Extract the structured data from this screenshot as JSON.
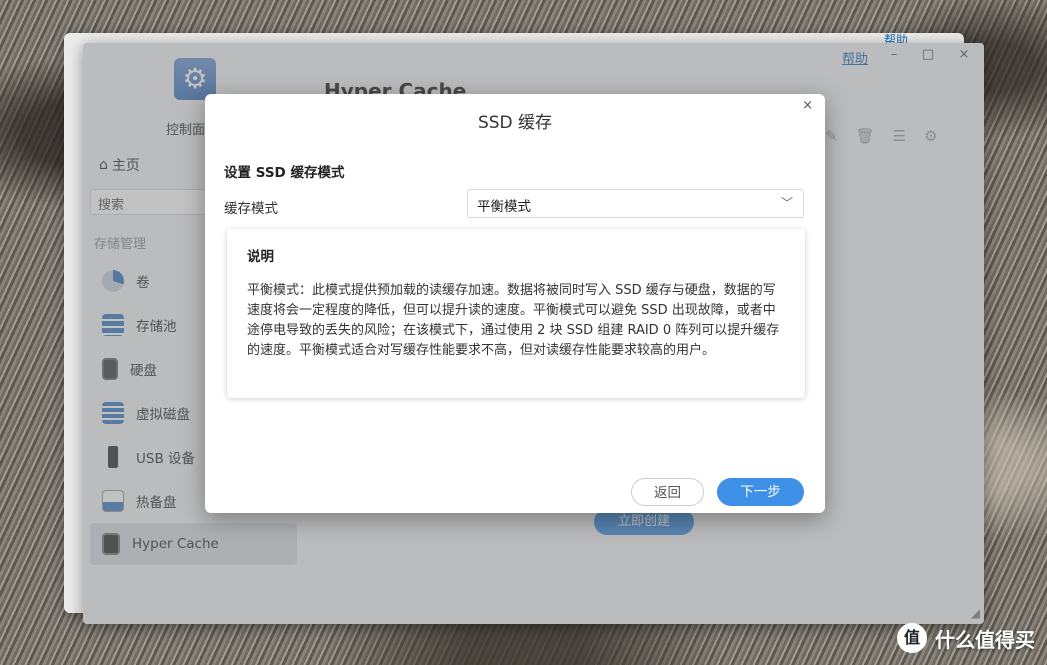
{
  "back_window": {
    "help": "帮助"
  },
  "window": {
    "help": "帮助",
    "minimize": "–",
    "maximize": "□",
    "close": "×",
    "app_name": "控制面",
    "content_title": "Hyper Cache",
    "create_button": "立即创建"
  },
  "sidebar": {
    "home": "主页",
    "search_placeholder": "搜索",
    "section": "存储管理",
    "items": [
      {
        "label": "卷",
        "icon": "volume-pie-icon"
      },
      {
        "label": "存储池",
        "icon": "storage-pool-icon"
      },
      {
        "label": "硬盘",
        "icon": "hard-disk-icon"
      },
      {
        "label": "虚拟磁盘",
        "icon": "virtual-disk-icon"
      },
      {
        "label": "USB 设备",
        "icon": "usb-device-icon"
      },
      {
        "label": "热备盘",
        "icon": "hot-spare-icon"
      },
      {
        "label": "Hyper Cache",
        "icon": "hyper-cache-icon"
      }
    ]
  },
  "modal": {
    "title": "SSD 缓存",
    "close": "×",
    "section_title": "设置 SSD 缓存模式",
    "mode_label": "缓存模式",
    "mode_value": "平衡模式",
    "desc_title": "说明",
    "desc_text": "平衡模式：此模式提供预加载的读缓存加速。数据将被同时写入 SSD 缓存与硬盘，数据的写速度将会一定程度的降低，但可以提升读的速度。平衡模式可以避免 SSD 出现故障，或者中途停电导致的丢失的风险；在该模式下，通过使用 2 块 SSD 组建 RAID 0 阵列可以提升缓存的速度。平衡模式适合对写缓存性能要求不高，但对读缓存性能要求较高的用户。",
    "back_button": "返回",
    "next_button": "下一步"
  },
  "watermark": {
    "logo": "值",
    "text": "什么值得买"
  },
  "colors": {
    "accent": "#3e90e6",
    "link": "#1d6fb8"
  }
}
